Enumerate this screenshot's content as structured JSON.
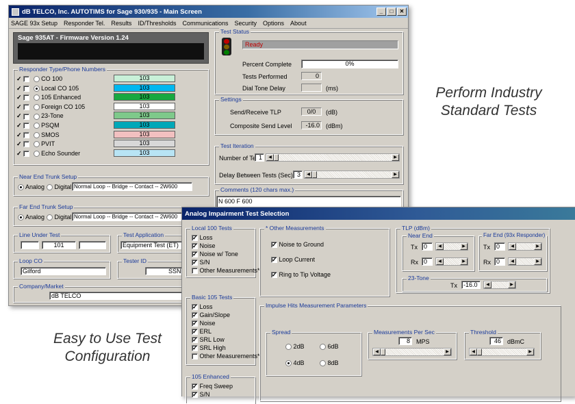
{
  "main": {
    "title": "dB TELCO, Inc. AUTOTIMS for Sage 930/935 - Main Screen",
    "menu": [
      "SAGE 93x Setup",
      "Responder Tel.",
      "Results",
      "ID/Thresholds",
      "Communications",
      "Security",
      "Options",
      "About"
    ],
    "banner": "Sage 935AT - Firmware Version 1.24",
    "responder": {
      "label": "Responder Type/Phone Numbers",
      "items": [
        {
          "name": "CO 100",
          "number": "103",
          "color": "#c8f0d8",
          "selected": false
        },
        {
          "name": "Local CO 105",
          "number": "103",
          "color": "#00b8f0",
          "selected": true
        },
        {
          "name": "105 Enhanced",
          "number": "103",
          "color": "#18a840",
          "selected": false
        },
        {
          "name": "Foreign CO 105",
          "number": "103",
          "color": "#ffffff",
          "selected": false
        },
        {
          "name": "23-Tone",
          "number": "103",
          "color": "#7ec98a",
          "selected": false
        },
        {
          "name": "PSQM",
          "number": "103",
          "color": "#00a8b8",
          "selected": false
        },
        {
          "name": "SMOS",
          "number": "103",
          "color": "#f2c0c0",
          "selected": false
        },
        {
          "name": "PVIT",
          "number": "103",
          "color": "#d8d8d8",
          "selected": false
        },
        {
          "name": "Echo Sounder",
          "number": "103",
          "color": "#b8e4f4",
          "selected": false
        }
      ]
    },
    "near_end": {
      "label": "Near End Trunk Setup",
      "analog": "Analog",
      "digital": "Digital",
      "value": "Normal Loop -- Bridge -- Contact -- 2W600"
    },
    "far_end": {
      "label": "Far End Trunk Setup",
      "analog": "Analog",
      "digital": "Digital",
      "value": "Normal Loop -- Bridge -- Contact -- 2W600"
    },
    "line_under_test": {
      "label": "Line Under Test",
      "value": "101"
    },
    "test_application": {
      "label": "Test Application",
      "value": "Equipment Test (ET)"
    },
    "loop_co": {
      "label": "Loop CO",
      "value": "Gilford"
    },
    "tester_id": {
      "label": "Tester ID",
      "value": "SSNN"
    },
    "company": {
      "label": "Company/Market",
      "value": "dB TELCO"
    },
    "test_status": {
      "label": "Test Status",
      "status": "Ready",
      "percent_label": "Percent Complete",
      "percent": "0%",
      "progress": 0,
      "performed_label": "Tests Performed",
      "performed": "0",
      "dialtone_label": "Dial Tone Delay",
      "dialtone": "",
      "dialtone_unit": "(ms)"
    },
    "settings": {
      "label": "Settings",
      "tlp_label": "Send/Receive TLP",
      "tlp": "0/0",
      "tlp_unit": "(dB)",
      "csl_label": "Composite Send Level",
      "csl": "-16.0",
      "csl_unit": "(dBm)"
    },
    "iteration": {
      "label": "Test Iteration",
      "num_label": "Number of Tests",
      "num": "1",
      "delay_label": "Delay Between Tests (Sec)",
      "delay": "3"
    },
    "comments": {
      "label": "Comments (120 chars max.)",
      "value": "N 600 F 600"
    }
  },
  "dialog": {
    "title": "Analog Impairment Test Selection",
    "local100": {
      "label": "Local 100 Tests",
      "items": [
        {
          "t": "Loss",
          "c": true
        },
        {
          "t": "Noise",
          "c": true
        },
        {
          "t": "Noise w/ Tone",
          "c": true
        },
        {
          "t": "S/N",
          "c": true
        },
        {
          "t": "Other Measurements*",
          "c": false
        }
      ]
    },
    "basic105": {
      "label": "Basic 105 Tests",
      "items": [
        {
          "t": "Loss",
          "c": true
        },
        {
          "t": "Gain/Slope",
          "c": true
        },
        {
          "t": "Noise",
          "c": true
        },
        {
          "t": "ERL",
          "c": true
        },
        {
          "t": "SRL Low",
          "c": true
        },
        {
          "t": "SRL High",
          "c": true
        },
        {
          "t": "Other Measurements*",
          "c": false
        }
      ]
    },
    "enh105": {
      "label": "105 Enhanced",
      "items": [
        {
          "t": "Freq Sweep",
          "c": true
        },
        {
          "t": "S/N",
          "c": true
        }
      ]
    },
    "other": {
      "label": "* Other Measurements",
      "items": [
        {
          "t": "Noise to Ground",
          "c": true
        },
        {
          "t": "Loop Current",
          "c": true
        },
        {
          "t": "Ring to Tip Voltage",
          "c": true
        }
      ]
    },
    "tlp": {
      "label": "TLP (dBm)",
      "near": "Near End",
      "far": "Far End (93x Responder)",
      "tx": "Tx",
      "rx": "Rx",
      "near_tx": "0",
      "near_rx": "0",
      "far_tx": "0",
      "far_rx": "0",
      "tone_label": "23-Tone",
      "tone_tx": "-16.0"
    },
    "impulse": {
      "label": "Impulse Hits Measurement Parameters",
      "spread": {
        "label": "Spread",
        "options": [
          "2dB",
          "6dB",
          "4dB",
          "8dB"
        ],
        "selected": "4dB"
      },
      "mps": {
        "label": "Measurements Per Sec",
        "value": "8",
        "unit": "MPS"
      },
      "threshold": {
        "label": "Threshold",
        "value": "46",
        "unit": "dBmC"
      }
    }
  },
  "captions": {
    "perform": "Perform Industry Standard Tests",
    "easy": "Easy to Use Test Configuration"
  }
}
